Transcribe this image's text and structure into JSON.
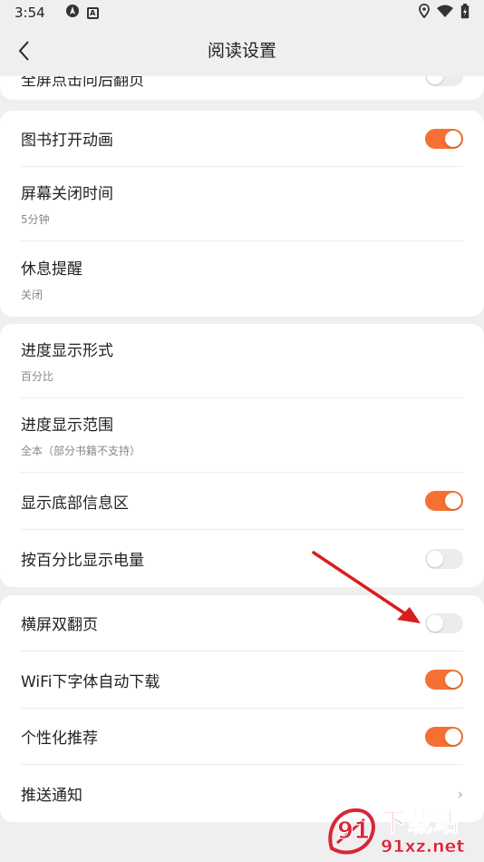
{
  "status_bar": {
    "time": "3:54",
    "left_icons": [
      "location-nav-icon",
      "a-notification-icon"
    ],
    "right_icons": [
      "location-pin-icon",
      "wifi-icon",
      "battery-charging-icon"
    ]
  },
  "header": {
    "title": "阅读设置",
    "back_icon": "chevron-left-icon"
  },
  "colors": {
    "accent": "#f57032",
    "toggle_off": "#ececec",
    "background": "#efefef",
    "arrow": "#d81e1e"
  },
  "sections": [
    {
      "items": [
        {
          "title": "全屏点击向后翻页",
          "type": "toggle",
          "on": false
        }
      ]
    },
    {
      "items": [
        {
          "title": "图书打开动画",
          "type": "toggle",
          "on": true
        },
        {
          "title": "屏幕关闭时间",
          "subtitle": "5分钟",
          "type": "nav"
        },
        {
          "title": "休息提醒",
          "subtitle": "关闭",
          "type": "nav"
        }
      ]
    },
    {
      "items": [
        {
          "title": "进度显示形式",
          "subtitle": "百分比",
          "type": "nav"
        },
        {
          "title": "进度显示范围",
          "subtitle": "全本（部分书籍不支持）",
          "type": "nav"
        },
        {
          "title": "显示底部信息区",
          "type": "toggle",
          "on": true
        },
        {
          "title": "按百分比显示电量",
          "type": "toggle",
          "on": false
        }
      ]
    },
    {
      "items": [
        {
          "title": "横屏双翻页",
          "type": "toggle",
          "on": false
        },
        {
          "title": "WiFi下字体自动下载",
          "type": "toggle",
          "on": true
        },
        {
          "title": "个性化推荐",
          "type": "toggle",
          "on": true
        },
        {
          "title": "推送通知",
          "type": "chevron",
          "chevron": "›"
        }
      ]
    }
  ],
  "watermark": {
    "logo_text": "91",
    "big_text": "下载站",
    "small_text": "91xz.net"
  }
}
